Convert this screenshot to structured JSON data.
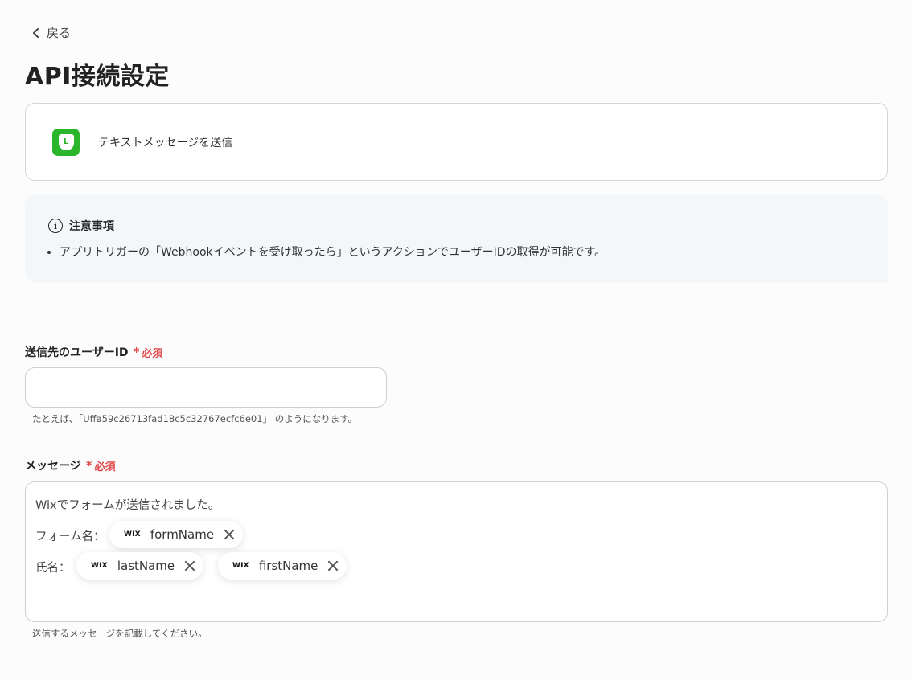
{
  "nav": {
    "back_label": "戻る"
  },
  "page": {
    "title": "API接続設定"
  },
  "app": {
    "action": "テキストメッセージを送信",
    "icon": "line-app-icon",
    "brand_color": "#2bb52b"
  },
  "notice": {
    "heading": "注意事項",
    "items": [
      "アプリトリガーの「Webhookイベントを受け取ったら」というアクションでユーザーIDの取得が可能です。"
    ]
  },
  "fields": {
    "user_id": {
      "label": "送信先のユーザーID",
      "required": "必須",
      "value": "",
      "hint": "たとえば､「Uffa59c26713fad18c5c32767ecfc6e01」 のようになります。"
    },
    "message": {
      "label": "メッセージ",
      "required": "必須",
      "line1": "Wixでフォームが送信されました。",
      "line2_label": "フォーム名：",
      "line3_label": "氏名：",
      "chips": [
        {
          "source": "WIX",
          "name": "formName"
        },
        {
          "source": "WIX",
          "name": "lastName"
        },
        {
          "source": "WIX",
          "name": "firstName"
        }
      ],
      "hint": "送信するメッセージを記載してください。"
    }
  },
  "colors": {
    "required": "#e04b4b",
    "notice_bg": "#f4f7fa"
  }
}
